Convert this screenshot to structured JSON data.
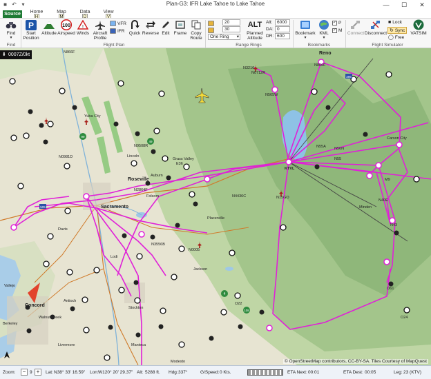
{
  "window": {
    "title": "Plan-G3: IFR Lake Tahoe to Lake Tahoe",
    "controls": {
      "minimize": "—",
      "maximize": "☐",
      "close": "✕"
    }
  },
  "tabs": {
    "file": "Source",
    "home": "Home",
    "home_key": "H",
    "map": "Map",
    "map_key": "M",
    "data": "Data",
    "data_key": "D",
    "view": "View",
    "view_key": "V"
  },
  "ribbon": {
    "find": "Find",
    "start_position": "Start Position",
    "altitude": "Altitude",
    "airspeed": "Airspeed",
    "airspeed_value": "100",
    "winds": "Winds",
    "aircraft_profile": "Aircraft Profile",
    "vfr": "VFR",
    "ifr": "IFR",
    "quick": "Quick",
    "reverse": "Reverse",
    "edit": "Edit",
    "frame": "Frame",
    "copy_route": "Copy Route",
    "ring1": "20",
    "ring2": "30",
    "ring_mode": "One Ring",
    "planned_altitude": "Planned Altitude",
    "alt_icon_text": "ALT",
    "alt_label": "Alt:",
    "alt_value": "6000",
    "da_label": "DA:",
    "da_value": "0",
    "dr_label": "DR:",
    "dr_value": "600",
    "bookmark": "Bookmark",
    "kml": "KML",
    "kml_p": "P",
    "kml_m": "M",
    "connect": "Connect",
    "disconnect": "Disconnect",
    "lock": "Lock",
    "sync": "Sync",
    "free": "Free",
    "vatsim": "VATSIM",
    "groups": {
      "find": "Find",
      "flight_plan": "Flight Plan",
      "range_rings": "Range Rings",
      "bookmarks": "Bookmarks",
      "simulator": "Flight Simulator"
    }
  },
  "map": {
    "time_tag": "0007Z/0kt",
    "copyright": "© OpenStreetMap contributors, CC-BY-SA. Tiles Courtesy of MapQuest",
    "labels": [
      {
        "text": "Reno"
      },
      {
        "text": "N806F"
      },
      {
        "text": "N3216"
      },
      {
        "text": "N0712R"
      },
      {
        "text": "N866F"
      },
      {
        "text": "N565W"
      },
      {
        "text": "KTVL"
      },
      {
        "text": "N55"
      },
      {
        "text": "Roseville"
      },
      {
        "text": "Sacramento"
      },
      {
        "text": "N40E"
      },
      {
        "text": "N56N"
      },
      {
        "text": "N55A"
      },
      {
        "text": "M9"
      },
      {
        "text": "N43"
      },
      {
        "text": "N15GO"
      },
      {
        "text": "Lincoln"
      },
      {
        "text": "Folsom"
      },
      {
        "text": "Concord"
      },
      {
        "text": "Antioch"
      },
      {
        "text": "Stockton"
      },
      {
        "text": "Vallejo"
      },
      {
        "text": "Berkeley"
      },
      {
        "text": "Modesto"
      },
      {
        "text": "Walnut Creek"
      },
      {
        "text": "Davis"
      },
      {
        "text": "Placerville"
      },
      {
        "text": "Minden"
      },
      {
        "text": "Carson City"
      },
      {
        "text": "Yuba City"
      },
      {
        "text": "Grass Valley"
      },
      {
        "text": "Auburn"
      },
      {
        "text": "Lodi"
      },
      {
        "text": "Livermore"
      },
      {
        "text": "Manteca"
      },
      {
        "text": "Jackson"
      },
      {
        "text": "N4436C"
      },
      {
        "text": "N0981D"
      },
      {
        "text": "N9508R"
      },
      {
        "text": "N2864F"
      },
      {
        "text": "N3556B"
      },
      {
        "text": "N0005"
      },
      {
        "text": "O24"
      },
      {
        "text": "O22"
      },
      {
        "text": "O61"
      },
      {
        "text": "E36"
      }
    ]
  },
  "status": {
    "zoom_label": "Zoom:",
    "zoom_value": "9",
    "lat_label": "Lat:",
    "lat_value": "N38° 33' 16.59\"",
    "lon_label": "Lon:",
    "lon_value": "W120° 20' 29.37\"",
    "alt_label": "Alt:",
    "alt_value": "5288 ft.",
    "hdg_label": "Hdg:",
    "hdg_value": "337°",
    "gs_label": "G/Speed:",
    "gs_value": "0 Kts.",
    "eta_next_label": "ETA Next:",
    "eta_next_value": "00:01",
    "eta_dest_label": "ETA Dest:",
    "eta_dest_value": "00:05",
    "leg_label": "Leg:",
    "leg_value": "23 (KTV)"
  },
  "colors": {
    "route": "#e020d8",
    "file_tab": "#1e7a34",
    "terrain_green": "#b9d3a0",
    "valley": "#ece7d2"
  }
}
